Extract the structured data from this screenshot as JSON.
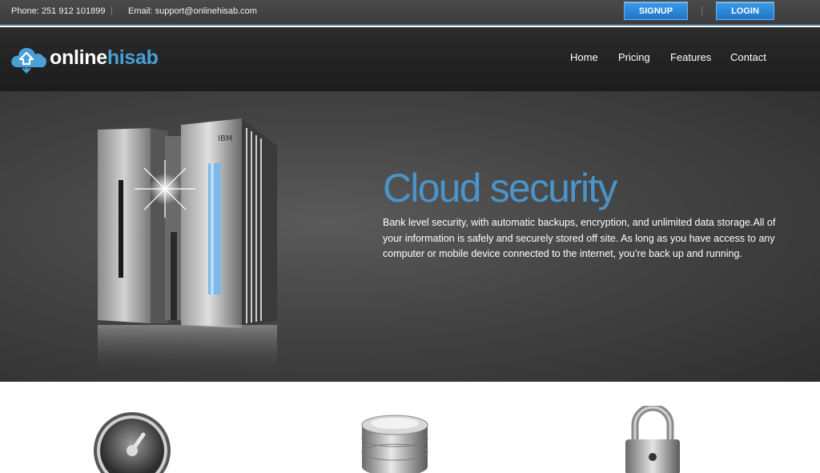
{
  "topbar": {
    "phone": "Phone: 251 912 101899",
    "email": "Email: support@onlinehisab.com",
    "signup_label": "SIGNUP",
    "login_label": "LOGIN"
  },
  "header": {
    "logo_part1": "online",
    "logo_part2": "hisab",
    "nav": {
      "home": "Home",
      "pricing": "Pricing",
      "features": "Features",
      "contact": "Contact"
    }
  },
  "hero": {
    "title": "Cloud security",
    "text": "Bank level security, with automatic backups, encryption, and unlimited data storage.All of your information is safely and securely stored off site. As long as you have access to any computer or mobile device connected to the internet, you’re back up and running.",
    "server_brand": "IBM"
  },
  "features": {
    "icons": [
      "speedometer-icon",
      "database-icon",
      "padlock-icon"
    ]
  },
  "colors": {
    "accent": "#4a94c9",
    "button": "#2a86d8",
    "topbar": "#444444",
    "header": "#222222"
  }
}
